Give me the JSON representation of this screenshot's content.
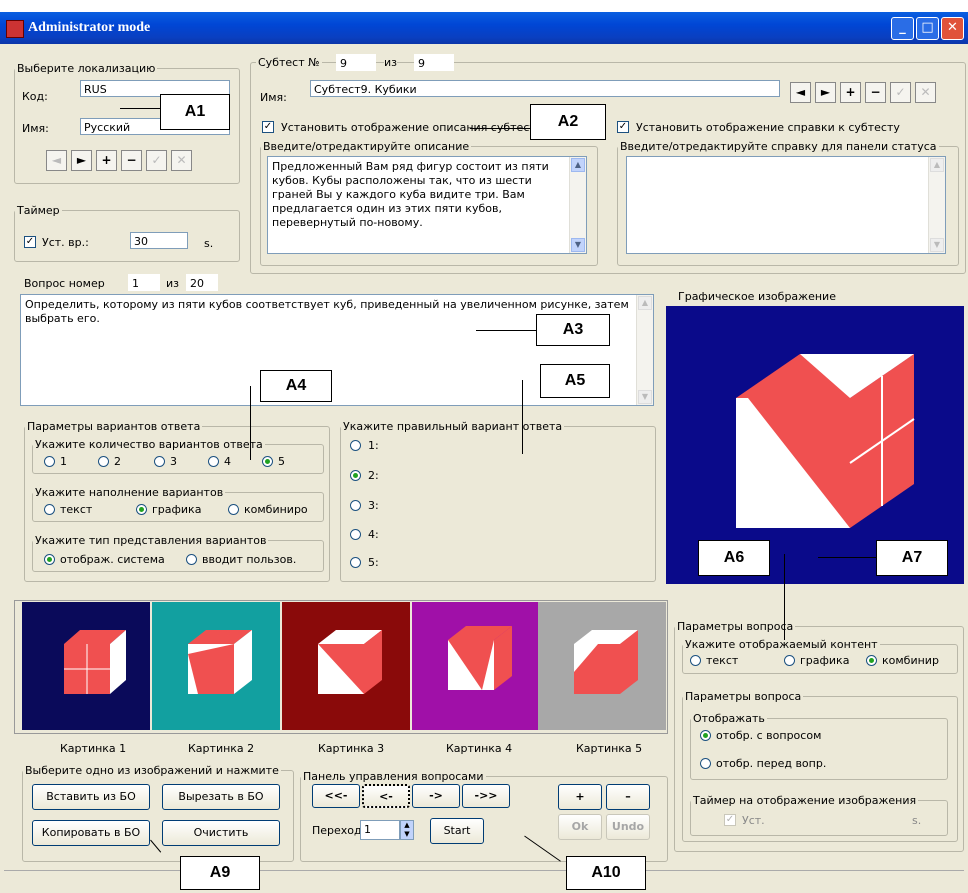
{
  "window": {
    "title": "Administrator mode"
  },
  "locale": {
    "legend": "Выберите локализацию",
    "code_label": "Код:",
    "code_value": "RUS",
    "name_label": "Имя:",
    "name_value": "Русский"
  },
  "timer": {
    "legend": "Таймер",
    "check_label": "Уст. вр.:",
    "value": "30",
    "unit": "s."
  },
  "subtest": {
    "num_label": "Субтест №",
    "num": "9",
    "of_label": "из",
    "total": "9",
    "name_label": "Имя:",
    "name_value": "Субтест9. Кубики",
    "show_desc_label": "Установить отображение описания субтеста",
    "show_help_label": "Установить отображение справки к субтесту",
    "desc_legend": "Введите/отредактируйте описание",
    "desc_text": "Предложенный Вам ряд фигур состоит из пяти кубов. Кубы расположены так, что из шести граней Вы у каждого куба видите три. Вам предлагается один из этих пяти кубов, перевернутый по-новому.",
    "help_legend": "Введите/отредактируйте справку для панели статуса"
  },
  "question": {
    "num_label": "Вопрос номер",
    "num": "1",
    "of_label": "из",
    "total": "20",
    "text": "Определить, которому из пяти кубов соответствует куб, приведенный на увеличенном рисунке, затем выбрать его."
  },
  "answer_params": {
    "legend": "Параметры вариантов ответа",
    "count_legend": "Укажите количество вариантов ответа",
    "counts": [
      "1",
      "2",
      "3",
      "4",
      "5"
    ],
    "count_selected": "5",
    "fill_legend": "Укажите наполнение вариантов",
    "fills": [
      "текст",
      "графика",
      "комбиниро"
    ],
    "fill_selected": "графика",
    "type_legend": "Укажите тип представления вариантов",
    "types": [
      "отображ. система",
      "вводит пользов."
    ],
    "type_selected": "отображ. система"
  },
  "correct": {
    "legend": "Укажите правильный вариант ответа",
    "options": [
      "1:",
      "2:",
      "3:",
      "4:",
      "5:"
    ],
    "selected": "2:"
  },
  "graphic": {
    "label": "Графическое изображение"
  },
  "pictures": {
    "labels": [
      "Картинка 1",
      "Картинка 2",
      "Картинка 3",
      "Картинка 4",
      "Картинка 5"
    ],
    "backgrounds": [
      "#0a0a5a",
      "#12a0a0",
      "#8a0a0a",
      "#a010a8",
      "#a8a8a8"
    ]
  },
  "image_actions": {
    "legend": "Выберите одно из изображений и нажмите",
    "insert": "Вставить из БО",
    "cut": "Вырезать в БО",
    "copy": "Копировать в БО",
    "clear": "Очистить"
  },
  "qpanel": {
    "legend": "Панель управления вопросами",
    "first": "<<-",
    "prev": "<-",
    "next": "->",
    "last": "->>",
    "goto_label": "Переход",
    "goto_value": "1",
    "start": "Start",
    "plus": "+",
    "minus": "–",
    "ok": "Ok",
    "undo": "Undo"
  },
  "qparams": {
    "legend": "Параметры вопроса",
    "content_legend": "Укажите отображаемый контент",
    "contents": [
      "текст",
      "графика",
      "комбинир"
    ],
    "content_selected": "комбинир",
    "inner_legend": "Параметры вопроса",
    "show_legend": "Отображать",
    "show_opts": [
      "отобр. с вопросом",
      "отобр. перед вопр."
    ],
    "show_selected": "отобр. с вопросом",
    "timer_legend": "Таймер на отображение изображения",
    "timer_check": "Уст.",
    "timer_unit": "s."
  },
  "annotations": [
    "A1",
    "A2",
    "A3",
    "A4",
    "A5",
    "A6",
    "A7",
    "A9",
    "A10"
  ],
  "icons": {
    "nav": [
      "prev-icon",
      "next-icon",
      "add-icon",
      "remove-icon",
      "confirm-icon",
      "cancel-icon"
    ]
  },
  "colors": {
    "titlebar": "#0046d5",
    "cube_face": "#f05050",
    "graphic_bg": "#0a0a8a"
  }
}
